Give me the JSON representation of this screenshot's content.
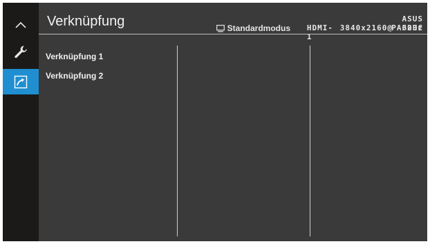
{
  "osd": {
    "title": "Verknüpfung",
    "status": {
      "mode": "Standardmodus",
      "input": "HDMI-1",
      "model": "ASUS PA32DC",
      "resolution": "3840x2160@",
      "refresh": "60Hz"
    },
    "sidebar": {
      "items": [
        {
          "icon": "chevron-up-icon",
          "active": false
        },
        {
          "icon": "wrench-icon",
          "active": false
        },
        {
          "icon": "shortcut-arrow-icon",
          "active": true
        }
      ]
    },
    "menu": {
      "items": [
        "Verknüpfung 1",
        "Verknüpfung 2"
      ]
    }
  },
  "colors": {
    "panel": "#3a3a3a",
    "sidebar": "#1b1a19",
    "accent": "#1f8fd1"
  }
}
